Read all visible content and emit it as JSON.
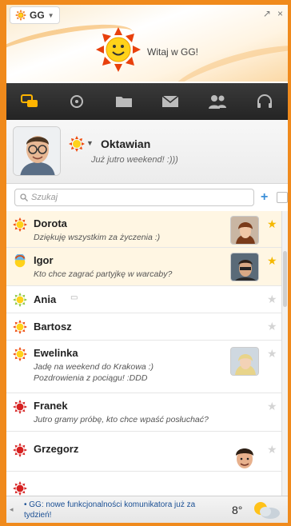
{
  "header": {
    "menu_label": "GG",
    "welcome_text": "Witaj w GG!",
    "minimize_label": "↗",
    "close_label": "×"
  },
  "toolbar": {
    "items": [
      "chat-icon",
      "status-icon",
      "folder-icon",
      "mail-icon",
      "contacts-icon",
      "headphones-icon"
    ]
  },
  "profile": {
    "name": "Oktawian",
    "status": "Już jutro weekend! :)))"
  },
  "search": {
    "placeholder": "Szukaj",
    "add_label": "+"
  },
  "contacts": [
    {
      "name": "Dorota",
      "desc": "Dziękuję wszystkim za życzenia :)",
      "status": "available",
      "star": true,
      "photo": true
    },
    {
      "name": "Igor",
      "desc": "Kto chce zagrać partyjkę w warcaby?",
      "status": "busy",
      "star": true,
      "photo": true
    },
    {
      "name": "Ania",
      "desc": "",
      "status": "available-green",
      "star": false,
      "photo": false
    },
    {
      "name": "Bartosz",
      "desc": "",
      "status": "available",
      "star": false,
      "photo": false
    },
    {
      "name": "Ewelinka",
      "desc": "Jadę na weekend do Krakowa :)\nPozdrowienia z pociągu! :DDD",
      "status": "available",
      "star": false,
      "photo": true
    },
    {
      "name": "Franek",
      "desc": "Jutro gramy próbę, kto chce wpaść posłuchać?",
      "status": "away",
      "star": false,
      "photo": false
    },
    {
      "name": "Grzegorz",
      "desc": "",
      "status": "away",
      "star": false,
      "photo": true
    }
  ],
  "news": {
    "text": "• GG: nowe funkcjonalności komunikatora już za tydzień!",
    "arrow": "◂"
  },
  "weather": {
    "temp": "8°"
  },
  "colors": {
    "frame": "#f08a1c",
    "accent": "#f5b800",
    "toolbar": "#2e2e2e"
  }
}
